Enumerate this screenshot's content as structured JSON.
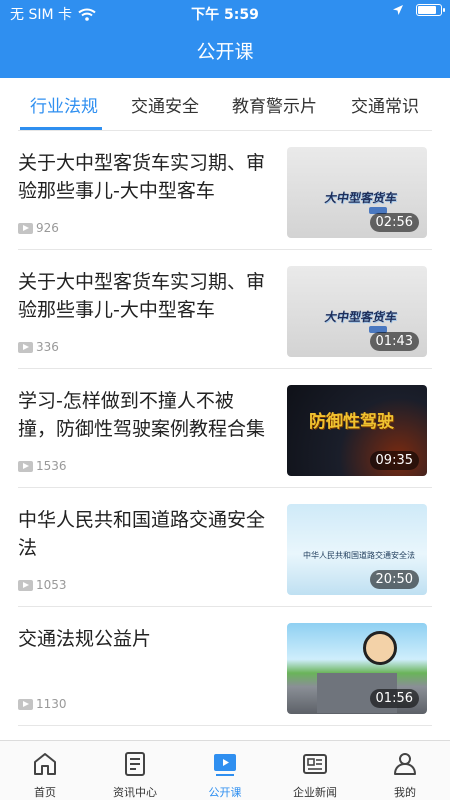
{
  "status_bar": {
    "carrier": "无 SIM 卡",
    "time": "下午 5:59"
  },
  "header": {
    "title": "公开课"
  },
  "tabs": [
    {
      "label": "行业法规",
      "active": true
    },
    {
      "label": "交通安全",
      "active": false
    },
    {
      "label": "教育警示片",
      "active": false
    },
    {
      "label": "交通常识",
      "active": false
    }
  ],
  "videos": [
    {
      "title": "关于大中型客货车实习期、审验那些事儿-大中型客车",
      "views": "926",
      "duration": "02:56",
      "thumb_text": "大中型客货车"
    },
    {
      "title": "关于大中型客货车实习期、审验那些事儿-大中型客车",
      "views": "336",
      "duration": "01:43",
      "thumb_text": "大中型客货车"
    },
    {
      "title": "学习-怎样做到不撞人不被撞，防御性驾驶案例教程合集",
      "views": "1536",
      "duration": "09:35",
      "thumb_text": "防御性驾驶"
    },
    {
      "title": "中华人民共和国道路交通安全法",
      "views": "1053",
      "duration": "20:50",
      "thumb_text": "中华人民共和国道路交通安全法"
    },
    {
      "title": "交通法规公益片",
      "views": "1130",
      "duration": "01:56",
      "thumb_text": ""
    }
  ],
  "bottom_nav": [
    {
      "label": "首页",
      "icon": "home-icon",
      "active": false
    },
    {
      "label": "资讯中心",
      "icon": "news-icon",
      "active": false
    },
    {
      "label": "公开课",
      "icon": "video-icon",
      "active": true
    },
    {
      "label": "企业新闻",
      "icon": "newspaper-icon",
      "active": false
    },
    {
      "label": "我的",
      "icon": "user-icon",
      "active": false
    }
  ],
  "colors": {
    "primary": "#2f8ff0",
    "text": "#222222",
    "muted": "#999999"
  }
}
